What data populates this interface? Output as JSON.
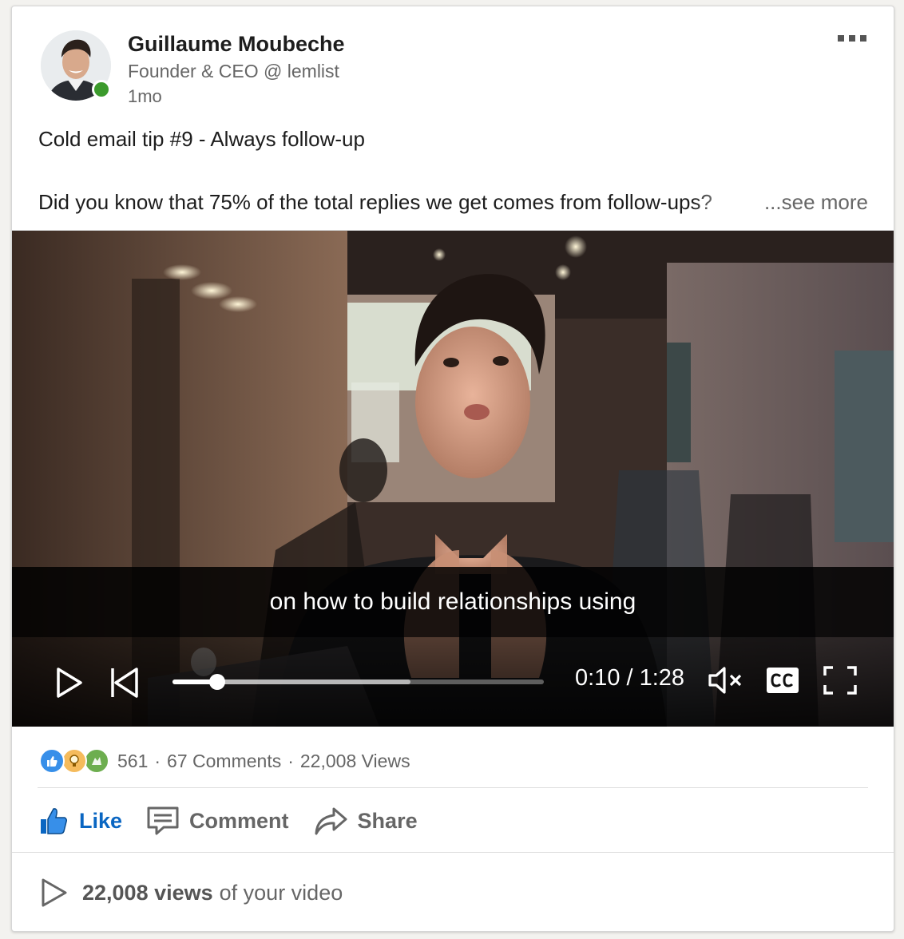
{
  "post": {
    "author_name": "Guillaume Moubeche",
    "author_title": "Founder & CEO @ lemlist",
    "posted_ago": "1mo",
    "text_line1": "Cold email tip #9 - Always follow-up",
    "text_line2": "Did you know that 75% of the total replies we get comes from follow-ups?",
    "see_more": "...see more",
    "online_status_color": "#3b9a2c"
  },
  "video": {
    "caption": "on how to build relationships using",
    "current_time": "0:10",
    "duration": "1:28",
    "time_label": "0:10 / 1:28",
    "played_fraction": 0.12,
    "buffered_fraction": 0.64,
    "muted": true,
    "icons": {
      "play": "play-icon",
      "skip_back": "skip-back-icon",
      "mute": "volume-muted-icon",
      "captions": "closed-captions-icon",
      "fullscreen": "fullscreen-icon"
    }
  },
  "social": {
    "reactions": [
      "like-reaction-icon",
      "insightful-reaction-icon",
      "celebrate-reaction-icon"
    ],
    "reaction_count": "561",
    "comments": "67 Comments",
    "views": "22,008 Views"
  },
  "actions": {
    "like": "Like",
    "comment": "Comment",
    "share": "Share",
    "like_color": "#0a66c2"
  },
  "footer": {
    "views_bold": "22,008 views",
    "views_suffix": "of your video"
  }
}
